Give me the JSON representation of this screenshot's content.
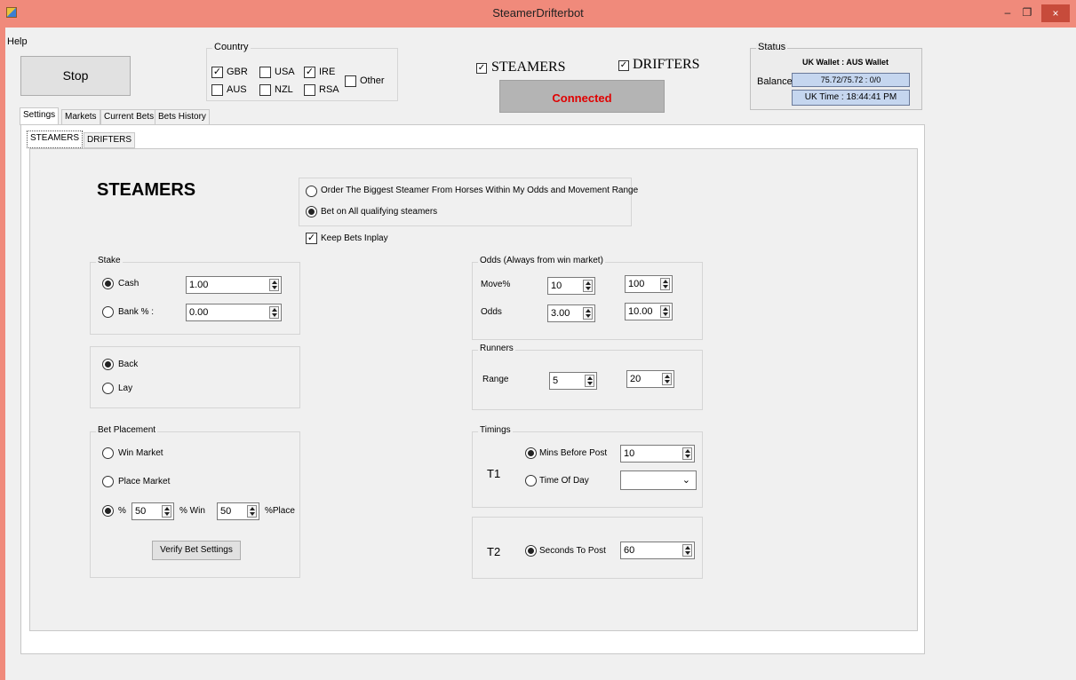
{
  "window": {
    "title": "SteamerDrifterbot",
    "minimize": "–",
    "maximize": "❐",
    "close": "×"
  },
  "menu": {
    "help": "Help"
  },
  "stop_button": "Stop",
  "country": {
    "title": "Country",
    "items": [
      {
        "label": "GBR",
        "checked": true
      },
      {
        "label": "USA",
        "checked": false
      },
      {
        "label": "IRE",
        "checked": true
      },
      {
        "label": "AUS",
        "checked": false
      },
      {
        "label": "NZL",
        "checked": false
      },
      {
        "label": "RSA",
        "checked": false
      },
      {
        "label": "Other",
        "checked": false
      }
    ]
  },
  "mode": {
    "steamers": {
      "label": "STEAMERS",
      "checked": true
    },
    "drifters": {
      "label": "DRIFTERS",
      "checked": true
    },
    "connection": "Connected",
    "connection_color": "#e00000"
  },
  "status": {
    "title": "Status",
    "wallet_header": "UK Wallet : AUS Wallet",
    "balance_label": "Balance",
    "balance_value": "75.72/75.72 : 0/0",
    "uk_time": "UK Time : 18:44:41 PM"
  },
  "main_tabs": [
    "Settings",
    "Markets",
    "Current Bets",
    "Bets History"
  ],
  "sub_tabs": [
    "STEAMERS",
    "DRIFTERS"
  ],
  "steamers_heading": "STEAMERS",
  "order_options": {
    "biggest": "Order The Biggest Steamer From Horses Within My Odds and Movement Range",
    "all": "Bet on All qualifying steamers"
  },
  "keep_inplay": "Keep Bets Inplay",
  "stake": {
    "title": "Stake",
    "cash_label": "Cash",
    "cash_value": "1.00",
    "bank_label": "Bank % :",
    "bank_value": "0.00"
  },
  "side": {
    "back": "Back",
    "lay": "Lay"
  },
  "bet_placement": {
    "title": "Bet Placement",
    "win_market": "Win Market",
    "place_market": "Place Market",
    "percent_label": "%",
    "win_value": "50",
    "win_label": "% Win",
    "place_value": "50",
    "place_label": "%Place",
    "verify_button": "Verify Bet Settings"
  },
  "odds": {
    "title": "Odds (Always from win market)",
    "move_label": "Move%",
    "move_min": "10",
    "move_max": "100",
    "odds_label": "Odds",
    "odds_min": "3.00",
    "odds_max": "10.00"
  },
  "runners": {
    "title": "Runners",
    "range_label": "Range",
    "min": "5",
    "max": "20"
  },
  "timings": {
    "title": "Timings",
    "t1_label": "T1",
    "mins_before_post": "Mins Before Post",
    "mins_value": "10",
    "time_of_day": "Time Of Day",
    "t2_label": "T2",
    "seconds_to_post": "Seconds To Post",
    "seconds_value": "60"
  },
  "colors": {
    "title_bar": "#f08a7b",
    "connected_bg": "#b4b4b4",
    "status_box_bg": "#c5d6ef"
  }
}
